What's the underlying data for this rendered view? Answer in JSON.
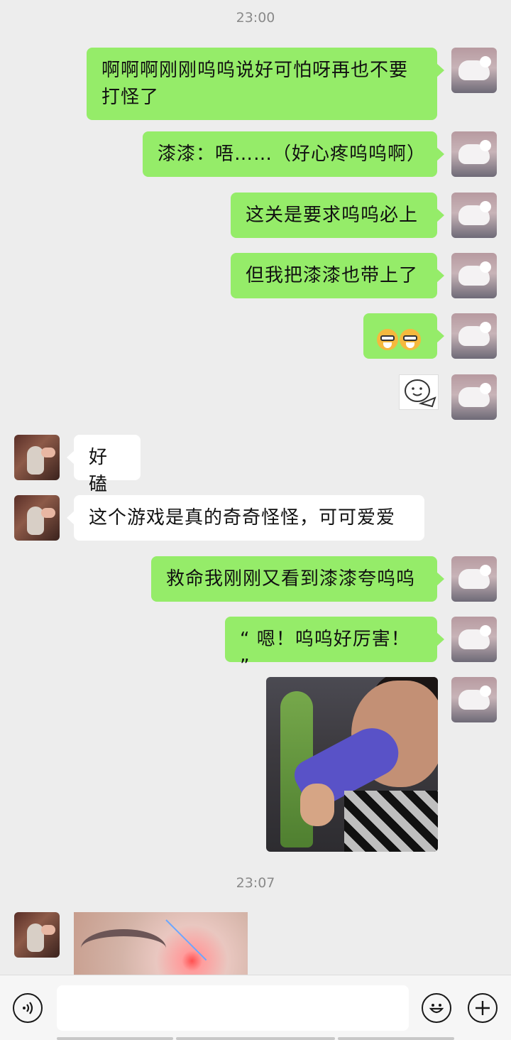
{
  "timestamps": [
    "23:00",
    "23:07"
  ],
  "messages": [
    {
      "side": "me",
      "text": "啊啊啊刚刚呜呜说好可怕呀再也不要打怪了"
    },
    {
      "side": "me",
      "text": "漆漆：唔……（好心疼呜呜啊）"
    },
    {
      "side": "me",
      "text": "这关是要求呜呜必上"
    },
    {
      "side": "me",
      "text": "但我把漆漆也带上了"
    },
    {
      "side": "me",
      "type": "emoji",
      "emoji": [
        "doge-glasses-emoji",
        "doge-glasses-emoji"
      ]
    },
    {
      "side": "me",
      "type": "sticker",
      "icon": "smiley-face-sticker"
    },
    {
      "side": "them",
      "text": "好磕"
    },
    {
      "side": "them",
      "text": "这个游戏是真的奇奇怪怪，可可爱爱"
    },
    {
      "side": "me",
      "text": "救命我刚刚又看到漆漆夸呜呜"
    },
    {
      "side": "me",
      "text": "“ 嗯！呜呜好厉害！ ”"
    },
    {
      "side": "me",
      "type": "image",
      "icon": "woman-biting-shoe-image"
    },
    {
      "side": "them",
      "type": "image",
      "icon": "glowing-eye-image"
    }
  ],
  "input_bar": {
    "voice_icon": "voice-icon",
    "emoji_icon": "emoji-icon",
    "plus_icon": "plus-icon",
    "text_value": ""
  },
  "colors": {
    "background": "#ededed",
    "my_bubble": "#95ec69",
    "their_bubble": "#ffffff"
  }
}
